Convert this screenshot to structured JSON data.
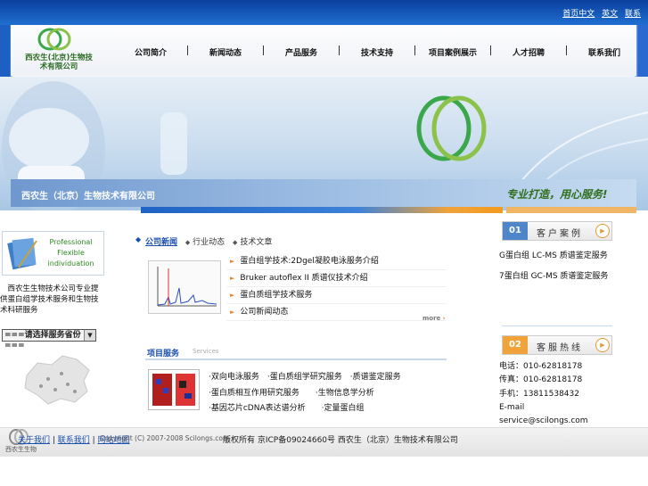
{
  "top_links": [
    "首页中文",
    "英文",
    "联系"
  ],
  "logo": {
    "name": "西农生(北京)生物技术有限公司"
  },
  "nav": [
    "公司简介",
    "新闻动态",
    "产品服务",
    "技术支持",
    "项目案例展示",
    "人才招聘",
    "联系我们"
  ],
  "banner": {
    "company": "西农生（北京）生物技术有限公司",
    "slogan": "专业打造，用心服务!"
  },
  "left": {
    "promo": [
      "Professional",
      "Flexible",
      "individuation"
    ],
    "desc": "　西农生生物技术公司专业提供蛋白组学技术服务和生物技术科研服务",
    "select": "===请选择服务省份==="
  },
  "tabs": [
    "公司新闻",
    "行业动态",
    "技术文章"
  ],
  "news": [
    "蛋白组学技术:2Dgel凝胶电泳服务介绍",
    "Bruker autoflex II 质谱仪技术介绍",
    "蛋白质组学技术服务",
    "公司新闻动态"
  ],
  "more": "more",
  "services": {
    "title": "项目服务",
    "subtitle": "Services",
    "items": [
      "·双向电泳服务　·蛋白质组学研究服务　·质谱鉴定服务",
      "·蛋白质相互作用研究服务　　·生物信息学分析",
      "·基因芯片cDNA表达谱分析　　·定量蛋白组"
    ]
  },
  "right": {
    "cases_num": "01",
    "cases_title": "客户案例",
    "cases": [
      "G蛋白组 LC-MS 质谱鉴定服务",
      "7蛋白组 GC-MS 质谱鉴定服务"
    ],
    "hotline_num": "02",
    "hotline_title": "客服热线",
    "contact": [
      "电话：010-62818178",
      "传真：010-62818178",
      "手机：13811538432",
      "E-mail",
      "service@scilongs.com"
    ]
  },
  "footer": {
    "logo_text": "西农生生物",
    "links": [
      "关于我们",
      "联系我们",
      "网站地图"
    ],
    "copyright": "Copyright (C) 2007-2008 Scilongs.com",
    "icp": "版权所有 京ICP备09024660号 西农生（北京）生物技术有限公司"
  },
  "colors": {
    "brand_blue": "#1d5fc2",
    "accent_orange": "#f39a1f",
    "link_blue": "#1a4fb0",
    "logo_green": "#3aa84a"
  }
}
